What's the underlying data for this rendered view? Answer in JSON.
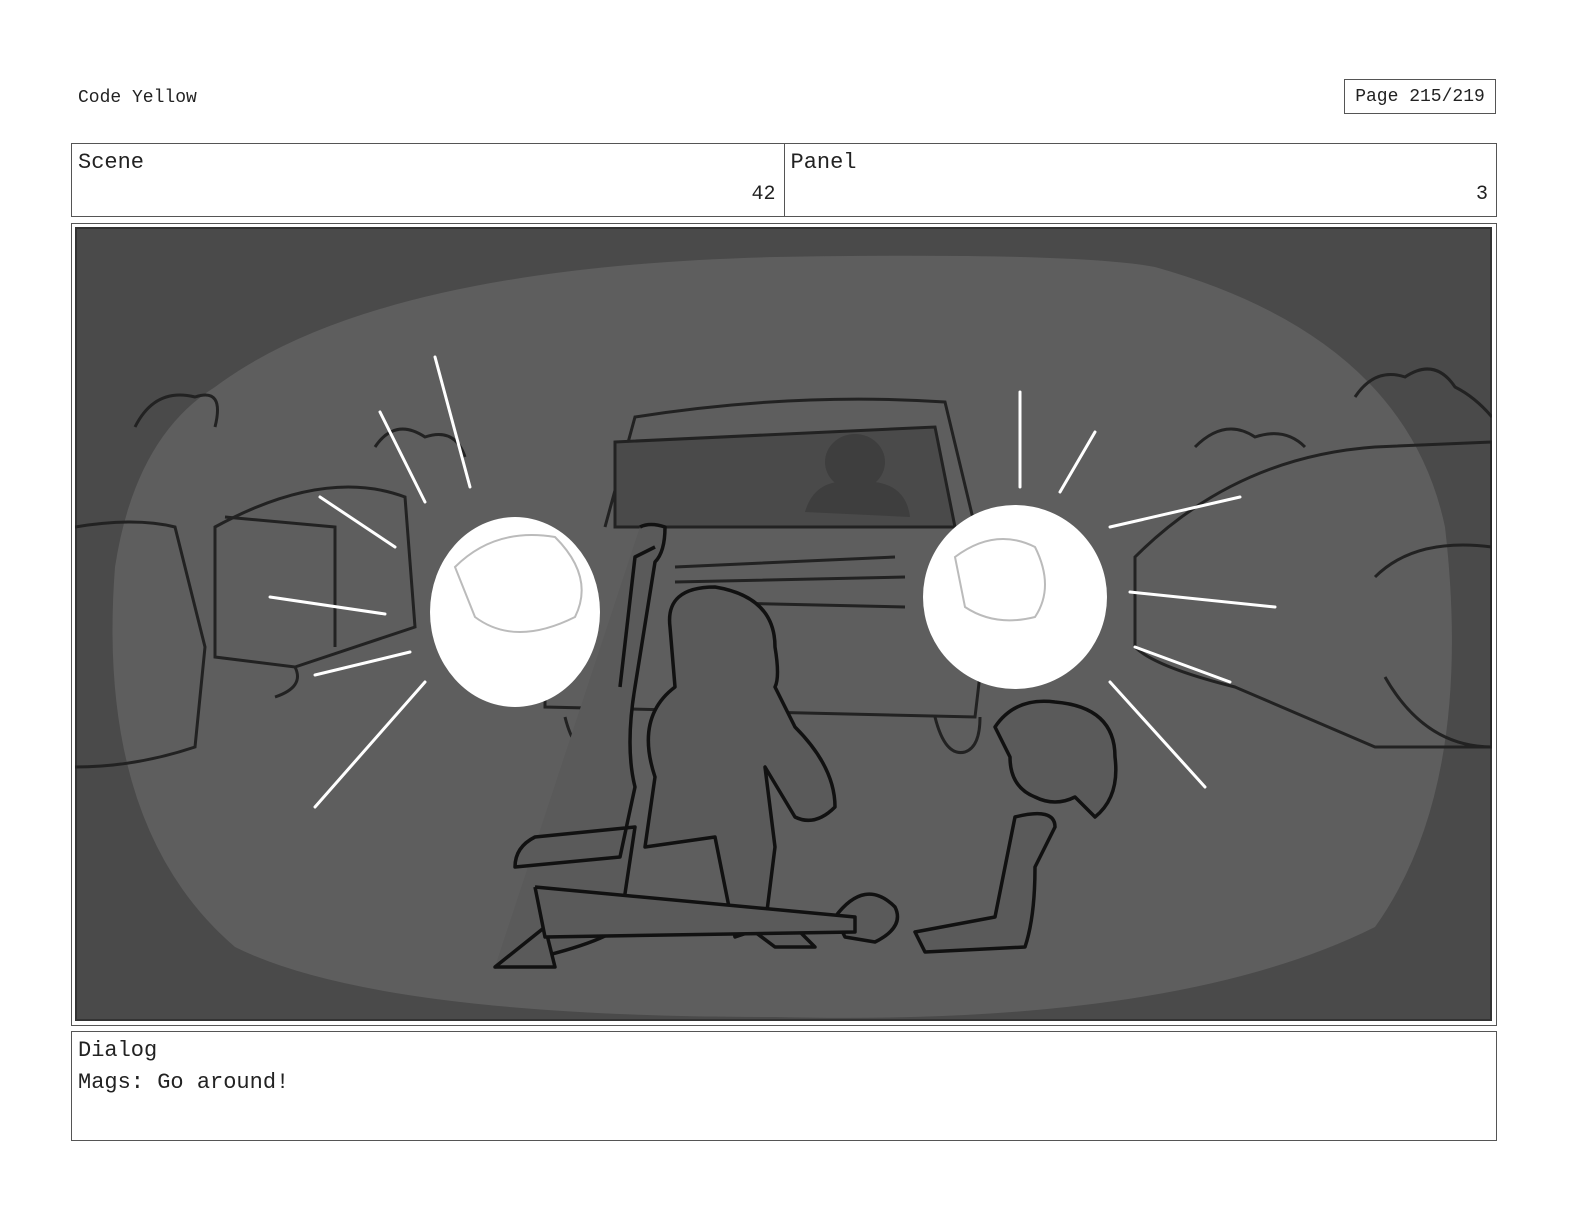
{
  "document": {
    "title": "Code Yellow",
    "page_label": "Page 215/219"
  },
  "scene": {
    "label": "Scene",
    "value": "42"
  },
  "panel": {
    "label": "Panel",
    "value": "3"
  },
  "image": {
    "description_icon": "storyboard-drawing",
    "colors": {
      "background": "#4a4a4a",
      "spotlight": "#5e5e5e",
      "headlight": "#ffffff",
      "ink": "#111111"
    }
  },
  "dialog": {
    "label": "Dialog",
    "line": "Mags: Go around!"
  }
}
